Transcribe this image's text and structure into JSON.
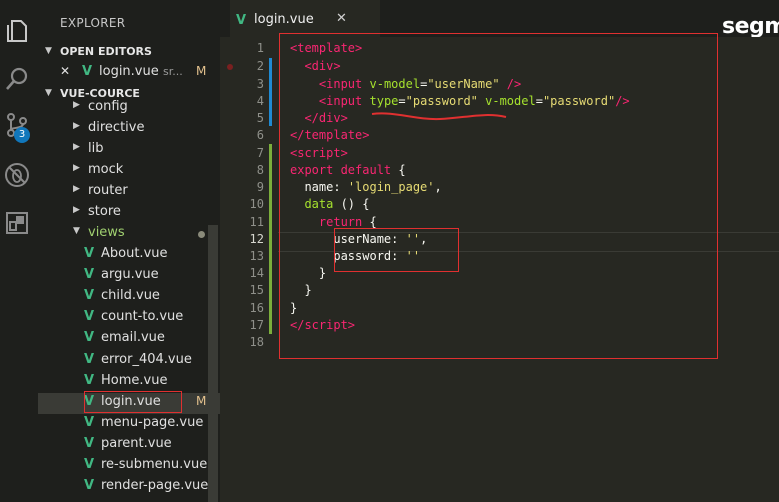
{
  "sidebar": {
    "title": "EXPLORER",
    "open_editors_label": "OPEN EDITORS",
    "open_editor": {
      "close": "✕",
      "name": "login.vue",
      "path": "sr...",
      "status": "M"
    },
    "project_label": "VUE-COURCE",
    "folders": [
      "config",
      "directive",
      "lib",
      "mock",
      "router",
      "store",
      "views"
    ],
    "files": [
      "About.vue",
      "argu.vue",
      "child.vue",
      "count-to.vue",
      "email.vue",
      "error_404.vue",
      "Home.vue",
      "login.vue",
      "menu-page.vue",
      "parent.vue",
      "re-submenu.vue",
      "render-page.vue"
    ],
    "file_status": {
      "login.vue": "M"
    }
  },
  "activity": {
    "scm_badge": "3"
  },
  "tab": {
    "name": "login.vue",
    "close": "✕"
  },
  "brand": "segm",
  "editor": {
    "line_numbers": [
      "1",
      "2",
      "3",
      "4",
      "5",
      "6",
      "7",
      "8",
      "9",
      "10",
      "11",
      "12",
      "13",
      "14",
      "15",
      "16",
      "17",
      "18"
    ]
  },
  "colors": {
    "accent_vue": "#41b883",
    "modified": "#e2c08d",
    "annotation_red": "#e03030"
  },
  "icons": [
    "files-icon",
    "search-icon",
    "source-control-icon",
    "no-bug-icon",
    "extensions-icon"
  ]
}
